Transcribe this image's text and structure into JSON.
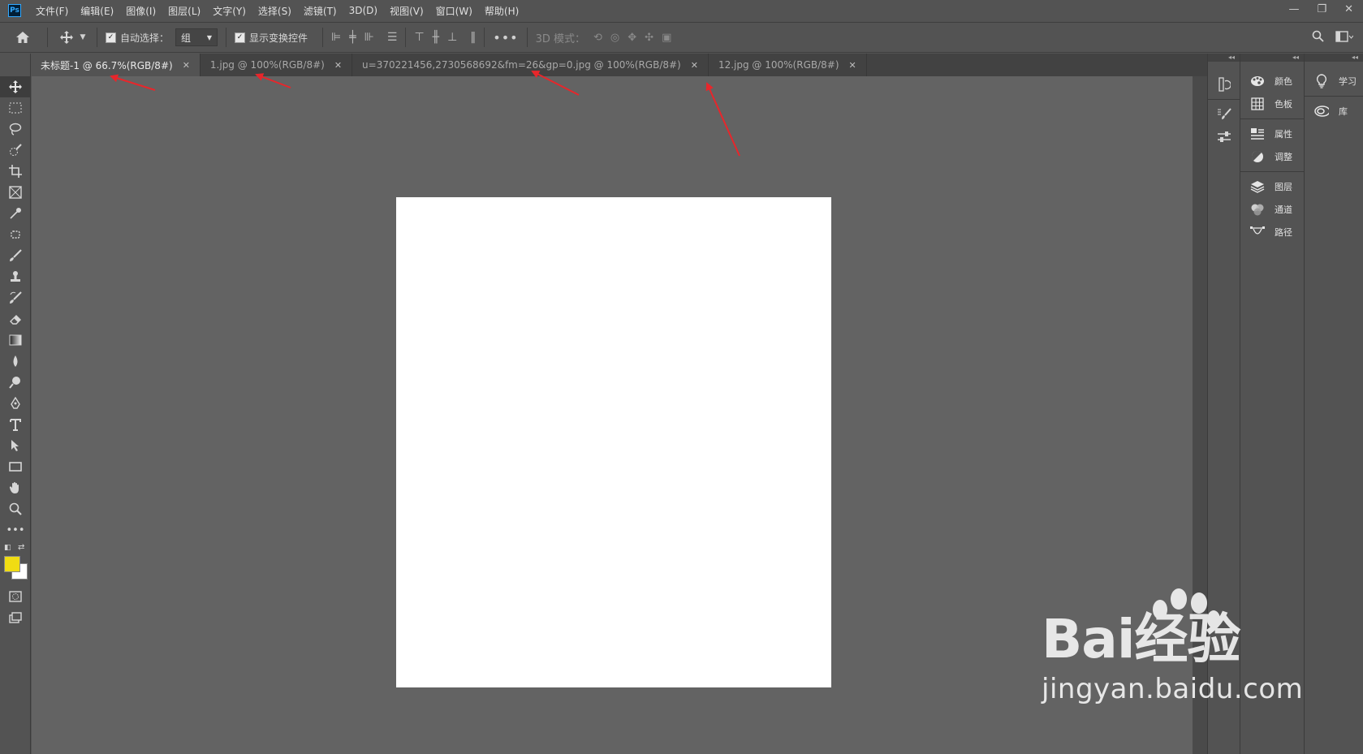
{
  "app": {
    "logo": "Ps"
  },
  "menu": {
    "items": [
      "文件(F)",
      "编辑(E)",
      "图像(I)",
      "图层(L)",
      "文字(Y)",
      "选择(S)",
      "滤镜(T)",
      "3D(D)",
      "视图(V)",
      "窗口(W)",
      "帮助(H)"
    ]
  },
  "window_controls": {
    "minimize": "—",
    "restore": "❐",
    "close": "✕"
  },
  "options_bar": {
    "auto_select_label": "自动选择：",
    "auto_select_checked": true,
    "auto_select_value": "组",
    "show_transform_label": "显示变换控件",
    "show_transform_checked": true,
    "mode_3d_label": "3D 模式："
  },
  "tabs": [
    {
      "label": "未标题-1 @ 66.7%(RGB/8#)",
      "active": true
    },
    {
      "label": "1.jpg @ 100%(RGB/8#)",
      "active": false
    },
    {
      "label": "u=370221456,2730568692&fm=26&gp=0.jpg @ 100%(RGB/8#)",
      "active": false
    },
    {
      "label": "12.jpg @ 100%(RGB/8#)",
      "active": false
    }
  ],
  "tab_close_glyph": "✕",
  "colors": {
    "foreground": "#f0dc13",
    "background": "#ffffff",
    "annotation_arrow": "#e8262b"
  },
  "tools": [
    "move-tool",
    "marquee-tool",
    "lasso-tool",
    "quick-select-tool",
    "crop-tool",
    "frame-tool",
    "eyedropper-tool",
    "healing-tool",
    "brush-tool",
    "stamp-tool",
    "history-brush-tool",
    "eraser-tool",
    "gradient-tool",
    "blur-tool",
    "dodge-tool",
    "pen-tool",
    "type-tool",
    "path-select-tool",
    "rectangle-tool",
    "hand-tool",
    "zoom-tool",
    "more-tools"
  ],
  "panels": {
    "group1": [
      {
        "icon": "palette-icon",
        "label": "颜色"
      },
      {
        "icon": "grid-icon",
        "label": "色板"
      }
    ],
    "group2": [
      {
        "icon": "properties-icon",
        "label": "属性"
      },
      {
        "icon": "adjust-icon",
        "label": "调整"
      }
    ],
    "group3": [
      {
        "icon": "layers-icon",
        "label": "图层"
      },
      {
        "icon": "channels-icon",
        "label": "通道"
      },
      {
        "icon": "paths-icon",
        "label": "路径"
      }
    ],
    "group4": [
      {
        "icon": "bulb-icon",
        "label": "学习"
      },
      {
        "icon": "library-icon",
        "label": "库"
      }
    ]
  },
  "watermark": {
    "logo_text": "Bai经验",
    "url": "jingyan.baidu.com"
  }
}
